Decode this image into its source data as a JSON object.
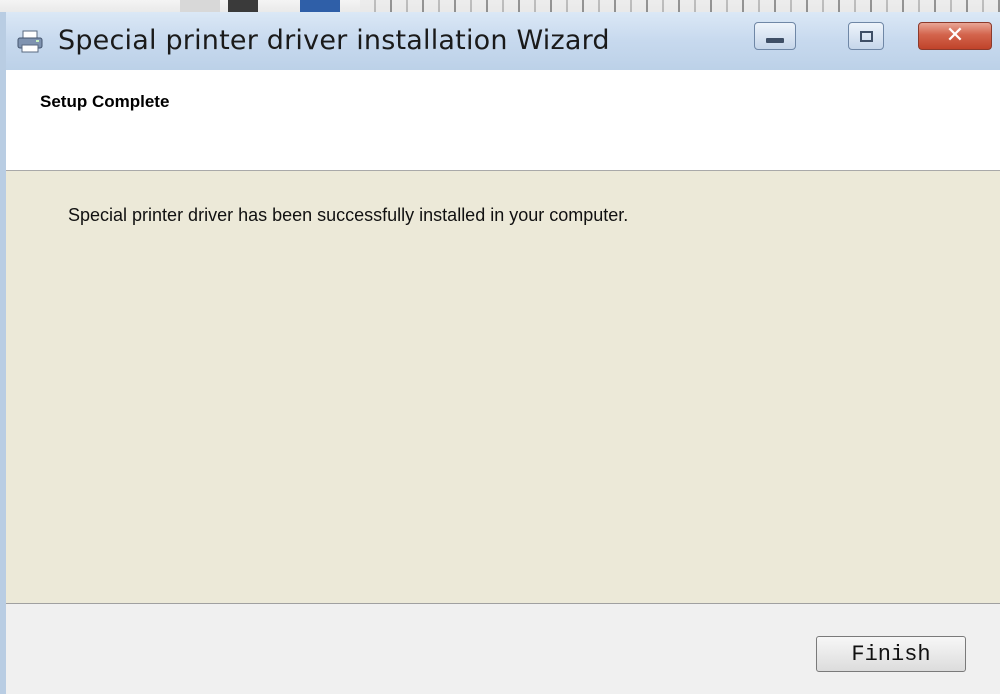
{
  "window": {
    "title": "Special printer driver installation Wizard",
    "icon": "printer-icon",
    "controls": {
      "minimize_icon": "minimize-icon",
      "maximize_icon": "maximize-icon",
      "close_glyph": "✕"
    }
  },
  "header": {
    "title": "Setup Complete"
  },
  "content": {
    "message": "Special printer driver has been successfully installed in your computer."
  },
  "footer": {
    "finish_label": "Finish"
  },
  "colors": {
    "titlebar": "#c7d9ee",
    "content_bg": "#ece9d8",
    "close_button": "#c7442c"
  }
}
